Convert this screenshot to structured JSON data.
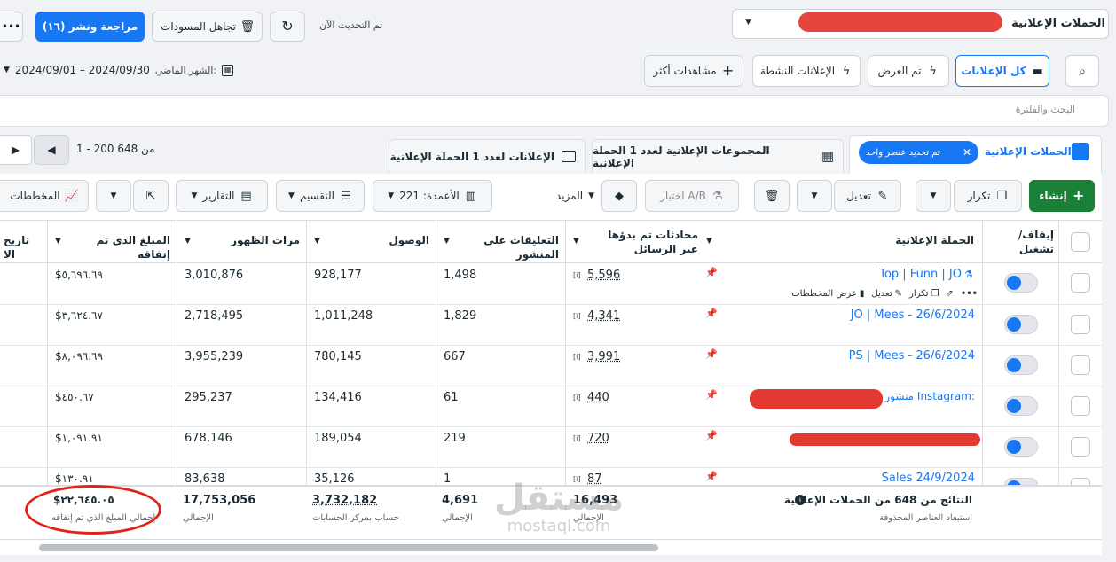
{
  "header": {
    "section_title": "الحملات الإعلانية",
    "review_publish": "مراجعة ونشر (١٦)",
    "discard_drafts": "تجاهل المسودات",
    "updated_text": "تم التحديث الآن",
    "more": "•••"
  },
  "filters": {
    "all_ads": "كل الإعلانات",
    "delivered": "تم العرض",
    "active_ads": "الإعلانات النشطة",
    "more_views": "مشاهدات أكثر",
    "date_label": "الشهر الماضي:",
    "date_range": "2024/09/01 – 2024/09/30"
  },
  "search": {
    "placeholder": "البحث والفلترة"
  },
  "pagination": {
    "text": "1 - 200 من 648"
  },
  "tabs": {
    "campaigns": "الحملات الإعلانية",
    "selected_chip": "تم تحديد عنصر واحد",
    "adsets": "المجموعات الإعلانية لعدد 1 الحملة الإعلانية",
    "ads": "الإعلانات لعدد 1 الحملة الإعلانية"
  },
  "toolbar": {
    "create": "إنشاء",
    "duplicate": "تكرار",
    "edit": "تعديل",
    "ab_test": "اختبار A/B",
    "more": "المزيد",
    "columns": "الأعمدة: 221",
    "breakdown": "التقسيم",
    "reports": "التقارير",
    "charts": "المخططات"
  },
  "table": {
    "headers": {
      "toggle": "إيقاف/ تشغيل",
      "campaign": "الحملة الإعلانية",
      "conversations": "محادثات تم بدؤها عبر الرسائل",
      "comments": "التعليقات على المنشور",
      "reach": "الوصول",
      "impressions": "مرات الظهور",
      "spent": "المبلغ الذي تم إنفاقه",
      "date": "تاريخ الا"
    },
    "row_actions": {
      "charts": "عرض المخططات",
      "edit": "تعديل",
      "duplicate": "تكرار"
    },
    "rows": [
      {
        "campaign": "Top | Funn | JO",
        "conversations": "5,596",
        "comments": "1,498",
        "reach": "928,177",
        "impressions": "3,010,876",
        "spent": "$٥,٦٩٦.٦٩"
      },
      {
        "campaign": "JO | Mees - 26/6/2024",
        "conversations": "4,341",
        "comments": "1,829",
        "reach": "1,011,248",
        "impressions": "2,718,495",
        "spent": "$٣,٦٢٤.٦٧"
      },
      {
        "campaign": "PS | Mees - 26/6/2024",
        "conversations": "3,991",
        "comments": "667",
        "reach": "780,145",
        "impressions": "3,955,239",
        "spent": "$٨,٠٩٦.٦٩"
      },
      {
        "campaign": "منشور Instagram:",
        "conversations": "440",
        "comments": "61",
        "reach": "134,416",
        "impressions": "295,237",
        "spent": "$٤٥٠.٦٧"
      },
      {
        "campaign": "",
        "conversations": "720",
        "comments": "219",
        "reach": "189,054",
        "impressions": "678,146",
        "spent": "$١,٠٩١.٩١"
      },
      {
        "campaign": "Sales 24/9/2024",
        "conversations": "87",
        "comments": "1",
        "reach": "35,126",
        "impressions": "83,638",
        "spent": "$١٣٠.٩١"
      }
    ],
    "totals": {
      "title": "النتائج من 648 من الحملات الإعلانية",
      "subtitle": "استبعاد العناصر المحذوفة",
      "conversations": "16,493",
      "conversations_sub": "الإجمالي",
      "comments": "4,691",
      "comments_sub": "الإجمالي",
      "reach": "3,732,182",
      "reach_sub": "حساب بمركز الحسابات",
      "impressions": "17,753,056",
      "impressions_sub": "الإجمالي",
      "spent": "$٢٢,٦٤٥.٠٥",
      "spent_sub": "إجمالي المبلغ الذي تم إنفاقه"
    }
  },
  "watermark": {
    "text": "مستقل",
    "sub": "mostaql.com"
  },
  "colors": {
    "accent": "#1877f2",
    "create": "#1a7f37",
    "annotation": "#e0241b"
  }
}
